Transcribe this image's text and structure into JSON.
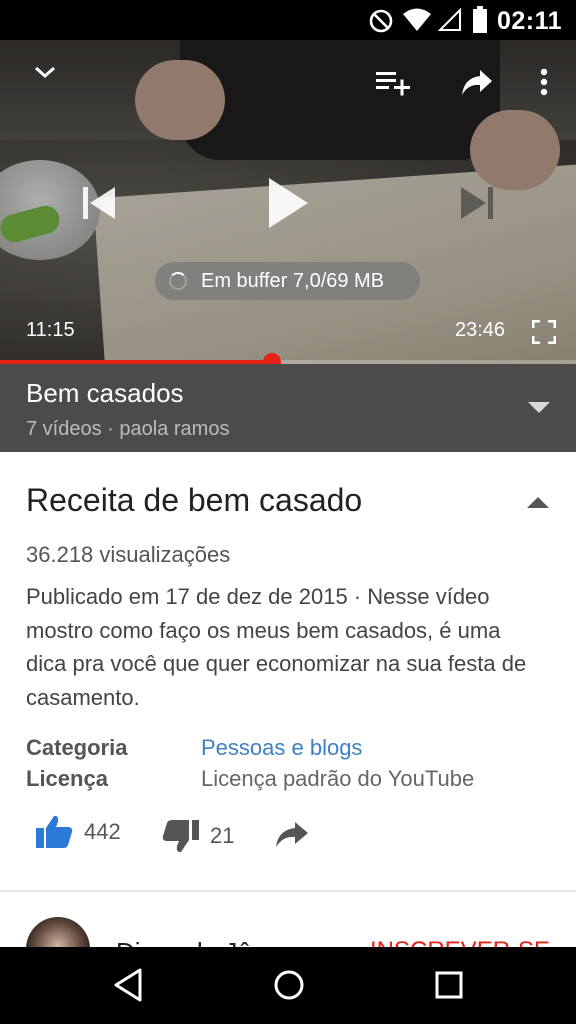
{
  "status_bar": {
    "time": "02:11",
    "icons": [
      "do-not-disturb-icon",
      "wifi-icon",
      "signal-icon",
      "battery-icon"
    ]
  },
  "player": {
    "buffer_text": "Em buffer 7,0/69 MB",
    "current_time": "11:15",
    "duration": "23:46",
    "progress_fraction": 0.473,
    "accent_color": "#e62117"
  },
  "playlist": {
    "title": "Bem casados",
    "subtitle": "7 vídeos · paola ramos"
  },
  "video": {
    "title": "Receita de bem casado",
    "views": "36.218 visualizações",
    "description": "Publicado em 17 de dez de 2015 · Nesse vídeo mostro como faço os meus bem casados, é uma dica pra você que quer economizar na sua festa de casamento.",
    "category_label": "Categoria",
    "category_value": "Pessoas e blogs",
    "license_label": "Licença",
    "license_value": "Licença padrão do YouTube",
    "likes": "442",
    "dislikes": "21"
  },
  "channel": {
    "name": "Dicas da Jô",
    "subscribe_label": "INSCREVER-SE"
  }
}
